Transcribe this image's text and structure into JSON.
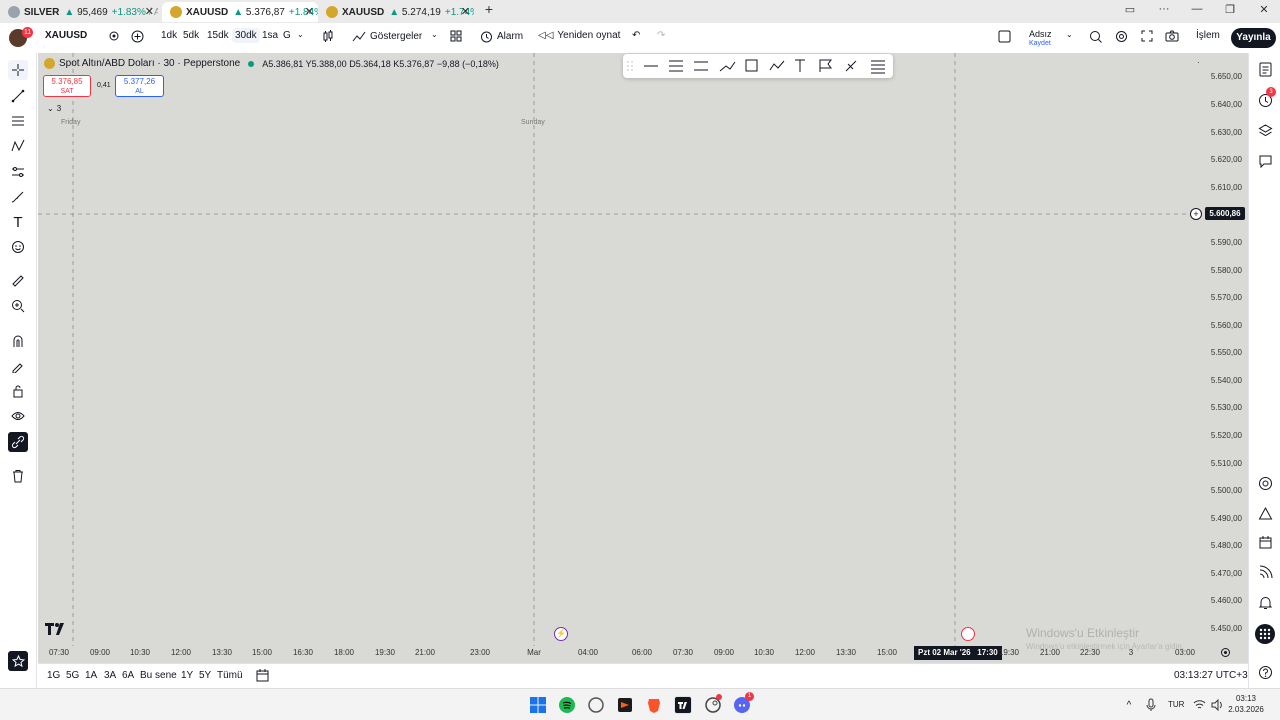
{
  "browser": {
    "tabs": [
      {
        "symbol": "SILVER",
        "arrow": "▲",
        "price": "95,469",
        "change": "+1.83%",
        "rest": "/ Adı"
      },
      {
        "symbol": "XAUUSD",
        "arrow": "▲",
        "price": "5.376,87",
        "change": "+1.84%",
        "rest": "/"
      },
      {
        "symbol": "XAUUSD",
        "arrow": "▲",
        "price": "5.274,19",
        "change": "+1.74%",
        "rest": "/"
      }
    ],
    "new_tab": "+"
  },
  "toolbar": {
    "avatar_badge": "11",
    "symbol": "XAUUSD",
    "intervals": [
      "1dk",
      "5dk",
      "15dk",
      "30dk",
      "1sa",
      "G"
    ],
    "active_interval": "30dk",
    "indicators": "Göstergeler",
    "alarm": "Alarm",
    "replay": "Yeniden oynat",
    "layout_name": "Adsız",
    "layout_save": "Kaydet",
    "trade": "İşlem",
    "publish": "Yayınla"
  },
  "legend": {
    "title": "Spot Altın/ABD Doları · 30 · Pepperstone",
    "a_label": "A",
    "a_value": "5.386,81",
    "y_label": "Y",
    "y_value": "5.388,00",
    "d_label": "D",
    "d_value": "5.364,18",
    "k_label": "K",
    "k_value": "5.376,87",
    "change": "−9,88 (−0,18%)",
    "sell_price": "5.376,85",
    "sell_label": "SAT",
    "spread": "0,41",
    "buy_price": "5.377,26",
    "buy_label": "AL",
    "collapse_count": "3"
  },
  "chart": {
    "day_labels": [
      "Friday",
      "Sunday"
    ],
    "price_labels": [
      "5.650,00",
      "5.640,00",
      "5.630,00",
      "5.620,00",
      "5.610,00",
      "5.600,00",
      "5.590,00",
      "5.580,00",
      "5.570,00",
      "5.560,00",
      "5.550,00",
      "5.540,00",
      "5.530,00",
      "5.520,00",
      "5.510,00",
      "5.500,00",
      "5.490,00",
      "5.480,00",
      "5.470,00",
      "5.460,00",
      "5.450,00"
    ],
    "crosshair_price": "5.600,86",
    "time_labels": [
      "07:30",
      "09:00",
      "10:30",
      "12:00",
      "13:30",
      "15:00",
      "16:30",
      "18:00",
      "19:30",
      "21:00",
      "23:00",
      "Mar",
      "04:00",
      "06:00",
      "07:30",
      "09:00",
      "10:30",
      "12:00",
      "13:30",
      "15:00",
      "19:30",
      "21:00",
      "22:30",
      "3",
      "03:00"
    ],
    "crosshair_time": "Pzt 02 Mar '26   17:30",
    "watermark_title": "Windows'u Etkinleştir",
    "watermark_sub": "Windows'u etkinleştirmek için Ayarlar'a gidin."
  },
  "bottom": {
    "ranges": [
      "1G",
      "5G",
      "1A",
      "3A",
      "6A",
      "Bu sene",
      "1Y",
      "5Y",
      "Tümü"
    ],
    "clock": "03:13:27 UTC+3"
  },
  "taskbar": {
    "lang": "TUR",
    "time": "03:13",
    "date": "2.03.2026",
    "discord_badge": "1"
  }
}
